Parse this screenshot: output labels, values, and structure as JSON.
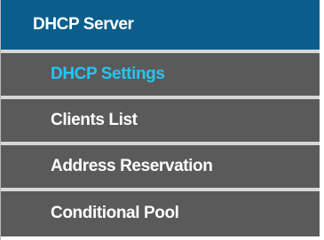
{
  "menu": {
    "header": "DHCP Server",
    "items": [
      {
        "label": "DHCP Settings",
        "active": true
      },
      {
        "label": "Clients List",
        "active": false
      },
      {
        "label": "Address Reservation",
        "active": false
      },
      {
        "label": "Conditional Pool",
        "active": false
      }
    ]
  },
  "colors": {
    "header_background": "#0b5d8c",
    "item_background": "#5a5a5a",
    "active_text": "#27c4f4",
    "item_text": "#ffffff",
    "divider": "#d7d7d7"
  }
}
